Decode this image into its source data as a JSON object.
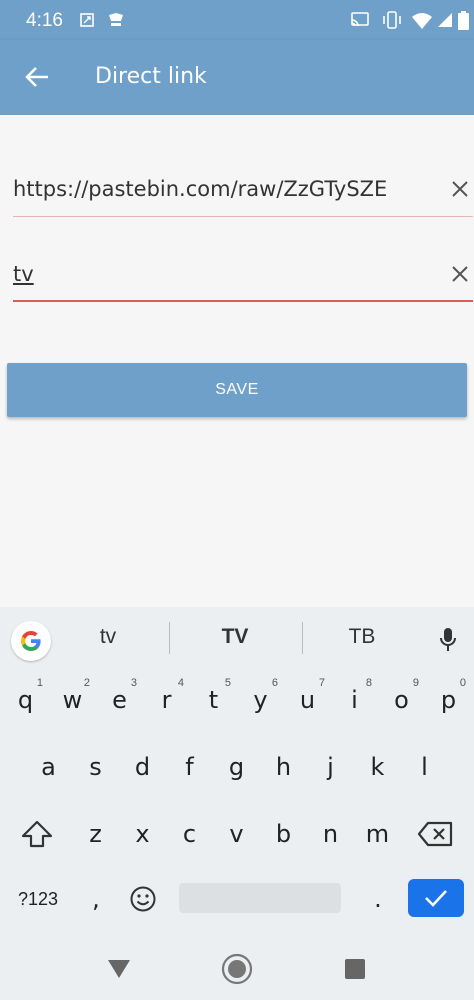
{
  "status_bar": {
    "time": "4:16",
    "icons": [
      "screenshot-icon",
      "notification-icon",
      "cast-icon",
      "vibrate-icon",
      "wifi-icon",
      "signal-icon",
      "battery-icon"
    ]
  },
  "app_bar": {
    "title": "Direct link",
    "back_icon": "arrow-left-icon",
    "color": "#6fa0c9"
  },
  "form": {
    "url_field": {
      "value": "https://pastebin.com/raw/ZzGTySZE",
      "clear_icon": "close-icon"
    },
    "name_field": {
      "value": "tv",
      "clear_icon": "close-icon"
    },
    "save_label": "SAVE"
  },
  "keyboard": {
    "suggestions": [
      "tv",
      "TV",
      "TB"
    ],
    "row1": [
      {
        "k": "q",
        "h": "1"
      },
      {
        "k": "w",
        "h": "2"
      },
      {
        "k": "e",
        "h": "3"
      },
      {
        "k": "r",
        "h": "4"
      },
      {
        "k": "t",
        "h": "5"
      },
      {
        "k": "y",
        "h": "6"
      },
      {
        "k": "u",
        "h": "7"
      },
      {
        "k": "i",
        "h": "8"
      },
      {
        "k": "o",
        "h": "9"
      },
      {
        "k": "p",
        "h": "0"
      }
    ],
    "row2": [
      "a",
      "s",
      "d",
      "f",
      "g",
      "h",
      "j",
      "k",
      "l"
    ],
    "row3": [
      "z",
      "x",
      "c",
      "v",
      "b",
      "n",
      "m"
    ],
    "sym_label": "?123",
    "comma": ",",
    "period": ".",
    "accent_color": "#1a73e8"
  },
  "nav_bar": {
    "buttons": [
      "back-triangle-icon",
      "home-circle-icon",
      "recents-square-icon"
    ]
  }
}
